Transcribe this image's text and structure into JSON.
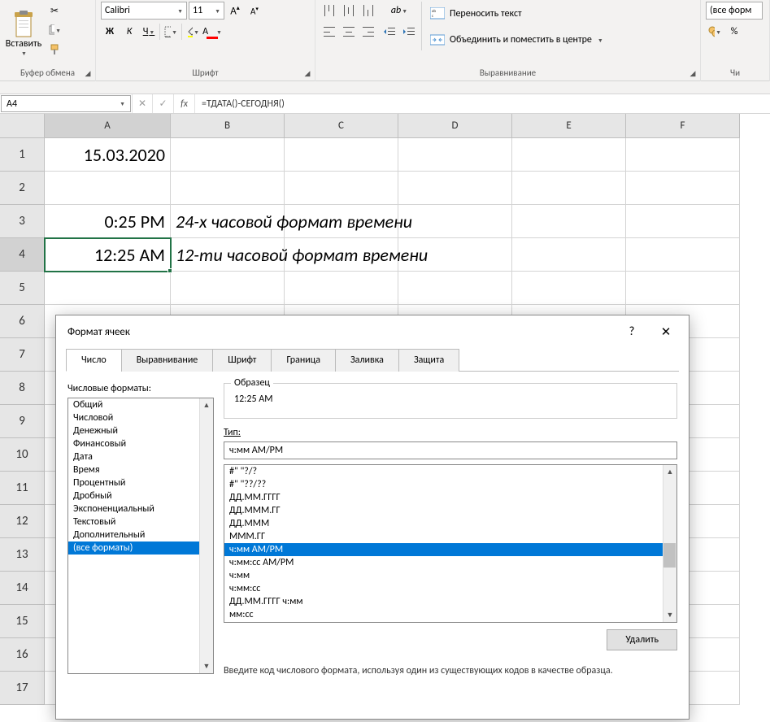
{
  "ribbon": {
    "clipboard": {
      "paste_label": "Вставить",
      "group": "Буфер обмена"
    },
    "font": {
      "name": "Calibri",
      "size": "11",
      "group": "Шрифт",
      "bold": "Ж",
      "italic": "К",
      "underline": "Ч",
      "increase": "A",
      "decrease": "A"
    },
    "align": {
      "group": "Выравнивание",
      "wrap": "Переносить текст",
      "merge": "Объединить и поместить в центре"
    },
    "number": {
      "group": "Чи",
      "format_label": "(все форм",
      "percent": "%"
    }
  },
  "formula_bar": {
    "name_box": "A4",
    "fx": "fx",
    "formula": "=ТДАТА()-СЕГОДНЯ()"
  },
  "grid": {
    "cols": [
      "A",
      "B",
      "C",
      "D",
      "E",
      "F"
    ],
    "rows": [
      "1",
      "2",
      "3",
      "4",
      "5",
      "6",
      "7",
      "8",
      "9",
      "10",
      "11",
      "12",
      "13",
      "14",
      "15",
      "16",
      "17"
    ],
    "cells": {
      "A1": "15.03.2020",
      "A3": "0:25 PM",
      "B3": "24-х часовой формат времени",
      "A4": "12:25 AM",
      "B4": "12-ти часовой формат времени"
    }
  },
  "dialog": {
    "title": "Формат ячеек",
    "tabs": [
      "Число",
      "Выравнивание",
      "Шрифт",
      "Граница",
      "Заливка",
      "Защита"
    ],
    "active_tab": 0,
    "categories_label": "Числовые форматы:",
    "categories": [
      "Общий",
      "Числовой",
      "Денежный",
      "Финансовый",
      "Дата",
      "Время",
      "Процентный",
      "Дробный",
      "Экспоненциальный",
      "Текстовый",
      "Дополнительный",
      "(все форматы)"
    ],
    "selected_category": 11,
    "sample_label": "Образец",
    "sample_value": "12:25 AM",
    "type_label": "Тип:",
    "type_value": "ч:мм AM/PM",
    "format_list": [
      "#\" \"?/?",
      "#\" \"??/??",
      "ДД.ММ.ГГГГ",
      "ДД.МММ.ГГ",
      "ДД.МММ",
      "МММ.ГГ",
      "ч:мм AM/PM",
      "ч:мм:сс AM/PM",
      "ч:мм",
      "ч:мм:сс",
      "ДД.ММ.ГГГГ ч:мм",
      "мм:сс"
    ],
    "selected_format": 6,
    "delete_btn": "Удалить",
    "hint": "Введите код числового формата, используя один из существующих кодов в качестве образца."
  }
}
